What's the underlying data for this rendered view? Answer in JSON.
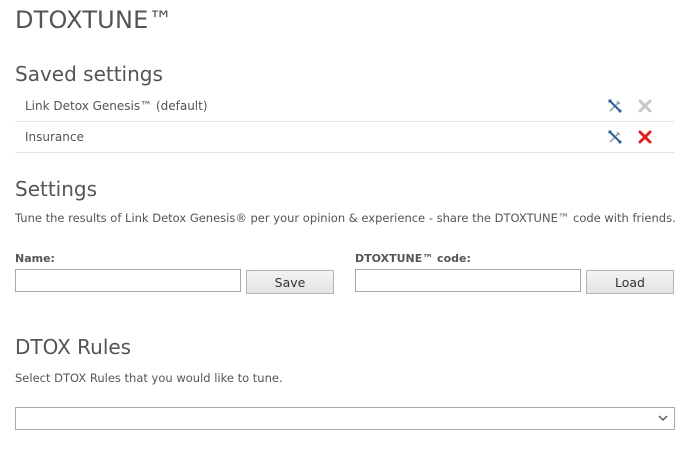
{
  "app": {
    "title": "DTOXTUNE™"
  },
  "saved_settings": {
    "heading": "Saved settings",
    "items": [
      {
        "label": "Link Detox Genesis™ (default)",
        "edit_icon": "tools-icon",
        "delete_icon": "delete-icon",
        "delete_enabled": false
      },
      {
        "label": "Insurance",
        "edit_icon": "tools-icon",
        "delete_icon": "delete-icon",
        "delete_enabled": true
      }
    ]
  },
  "settings": {
    "heading": "Settings",
    "description": "Tune the results of Link Detox Genesis® per your opinion & experience - share the DTOXTUNE™ code with friends.",
    "name_label": "Name:",
    "name_value": "",
    "save_label": "Save",
    "code_label": "DTOXTUNE™ code:",
    "code_value": "",
    "load_label": "Load"
  },
  "rules": {
    "heading": "DTOX Rules",
    "description": "Select DTOX Rules that you would like to tune.",
    "selected": ""
  },
  "colors": {
    "text": "#555555",
    "delete_active": "#e02020",
    "delete_disabled": "#c8c8c8",
    "tool_blue": "#2c5f9e",
    "divider": "#e3e3e3"
  }
}
